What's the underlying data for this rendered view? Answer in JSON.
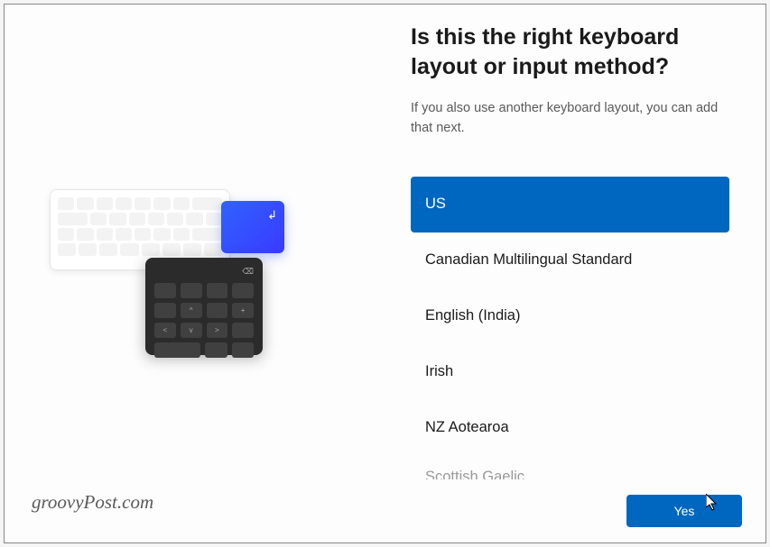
{
  "heading": "Is this the right keyboard layout or input method?",
  "subheading": "If you also use another keyboard layout, you can add that next.",
  "layouts": [
    "US",
    "Canadian Multilingual Standard",
    "English (India)",
    "Irish",
    "NZ Aotearoa",
    "Scottish Gaelic"
  ],
  "selected_index": 0,
  "primary_button": "Yes",
  "watermark": "groovyPost.com",
  "colors": {
    "accent": "#0067c0"
  }
}
